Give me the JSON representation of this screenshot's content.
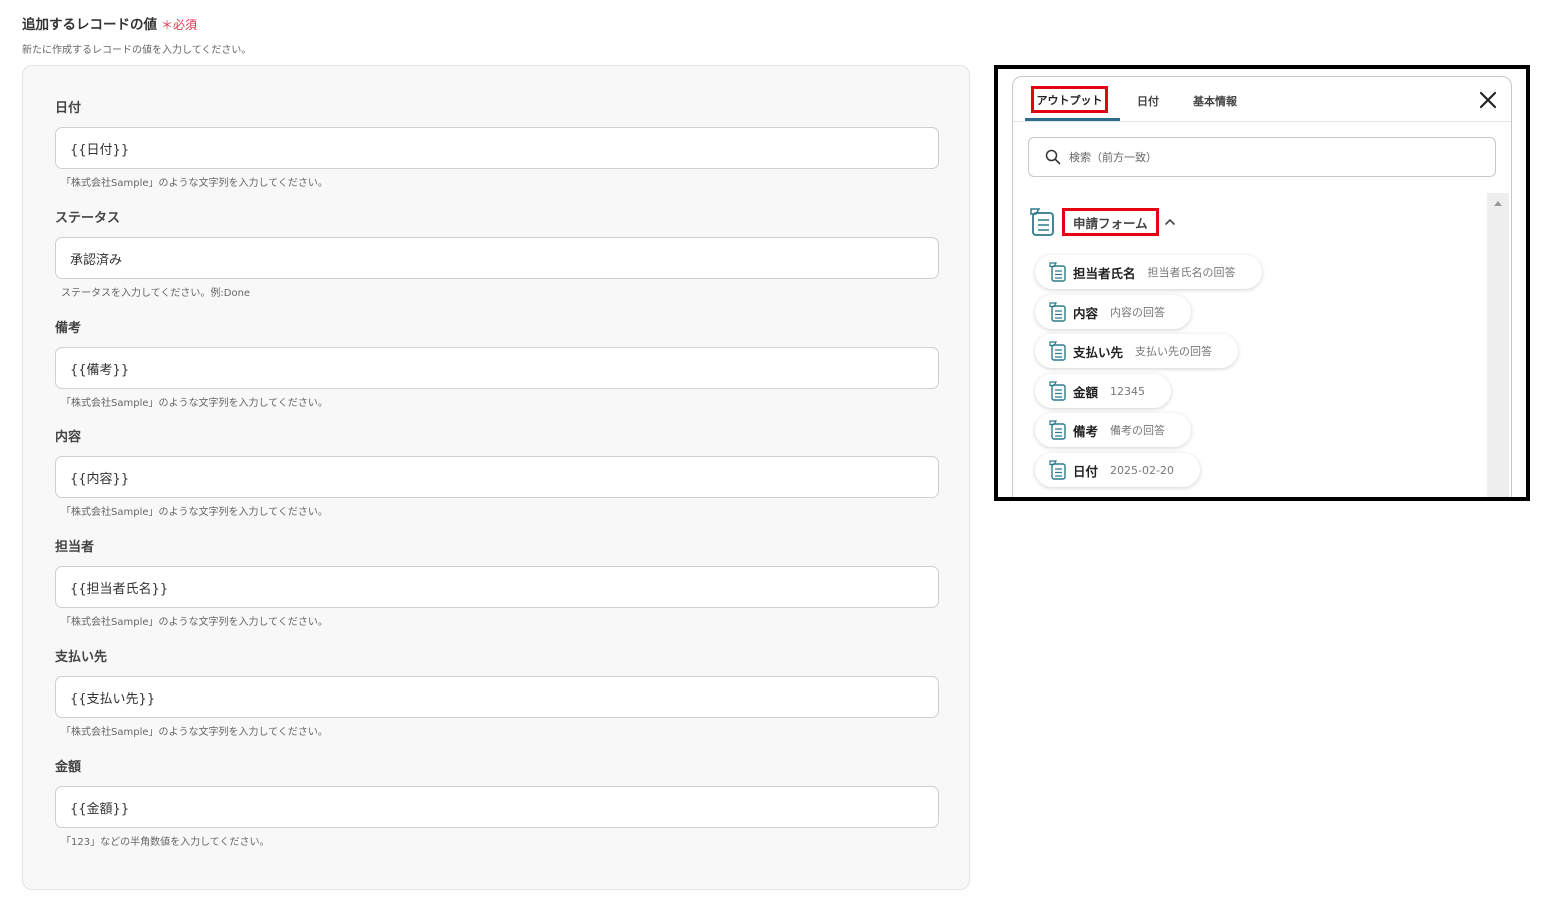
{
  "section": {
    "title": "追加するレコードの値",
    "required_mark": "＊",
    "required_label": "必須",
    "description": "新たに作成するレコードの値を入力してください。"
  },
  "fields": [
    {
      "label": "日付",
      "value": "{{日付}}",
      "help": "「株式会社Sample」のような文字列を入力してください。"
    },
    {
      "label": "ステータス",
      "value": "承認済み",
      "help": "ステータスを入力してください。例:Done"
    },
    {
      "label": "備考",
      "value": "{{備考}}",
      "help": "「株式会社Sample」のような文字列を入力してください。"
    },
    {
      "label": "内容",
      "value": "{{内容}}",
      "help": "「株式会社Sample」のような文字列を入力してください。"
    },
    {
      "label": "担当者",
      "value": "{{担当者氏名}}",
      "help": "「株式会社Sample」のような文字列を入力してください。"
    },
    {
      "label": "支払い先",
      "value": "{{支払い先}}",
      "help": "「株式会社Sample」のような文字列を入力してください。"
    },
    {
      "label": "金額",
      "value": "{{金額}}",
      "help": "「123」などの半角数値を入力してください。"
    }
  ],
  "popup": {
    "tabs": [
      "アウトプット",
      "日付",
      "基本情報"
    ],
    "active_tab": "アウトプット",
    "search_placeholder": "検索（前方一致）",
    "group": {
      "name": "申請フォーム",
      "items": [
        {
          "name": "担当者氏名",
          "value": "担当者氏名の回答"
        },
        {
          "name": "内容",
          "value": "内容の回答"
        },
        {
          "name": "支払い先",
          "value": "支払い先の回答"
        },
        {
          "name": "金額",
          "value": "12345"
        },
        {
          "name": "備考",
          "value": "備考の回答"
        },
        {
          "name": "日付",
          "value": "2025-02-20"
        }
      ]
    }
  },
  "colors": {
    "required": "#e6334a",
    "highlight": "#e60012",
    "tab_underline": "#2b6e8a",
    "icon": "#2b7a8c"
  },
  "icons": {
    "search": "search-icon",
    "close": "close-icon",
    "form": "form-icon",
    "collapse": "chevron-up-icon",
    "scroll_up": "scroll-up-icon"
  }
}
